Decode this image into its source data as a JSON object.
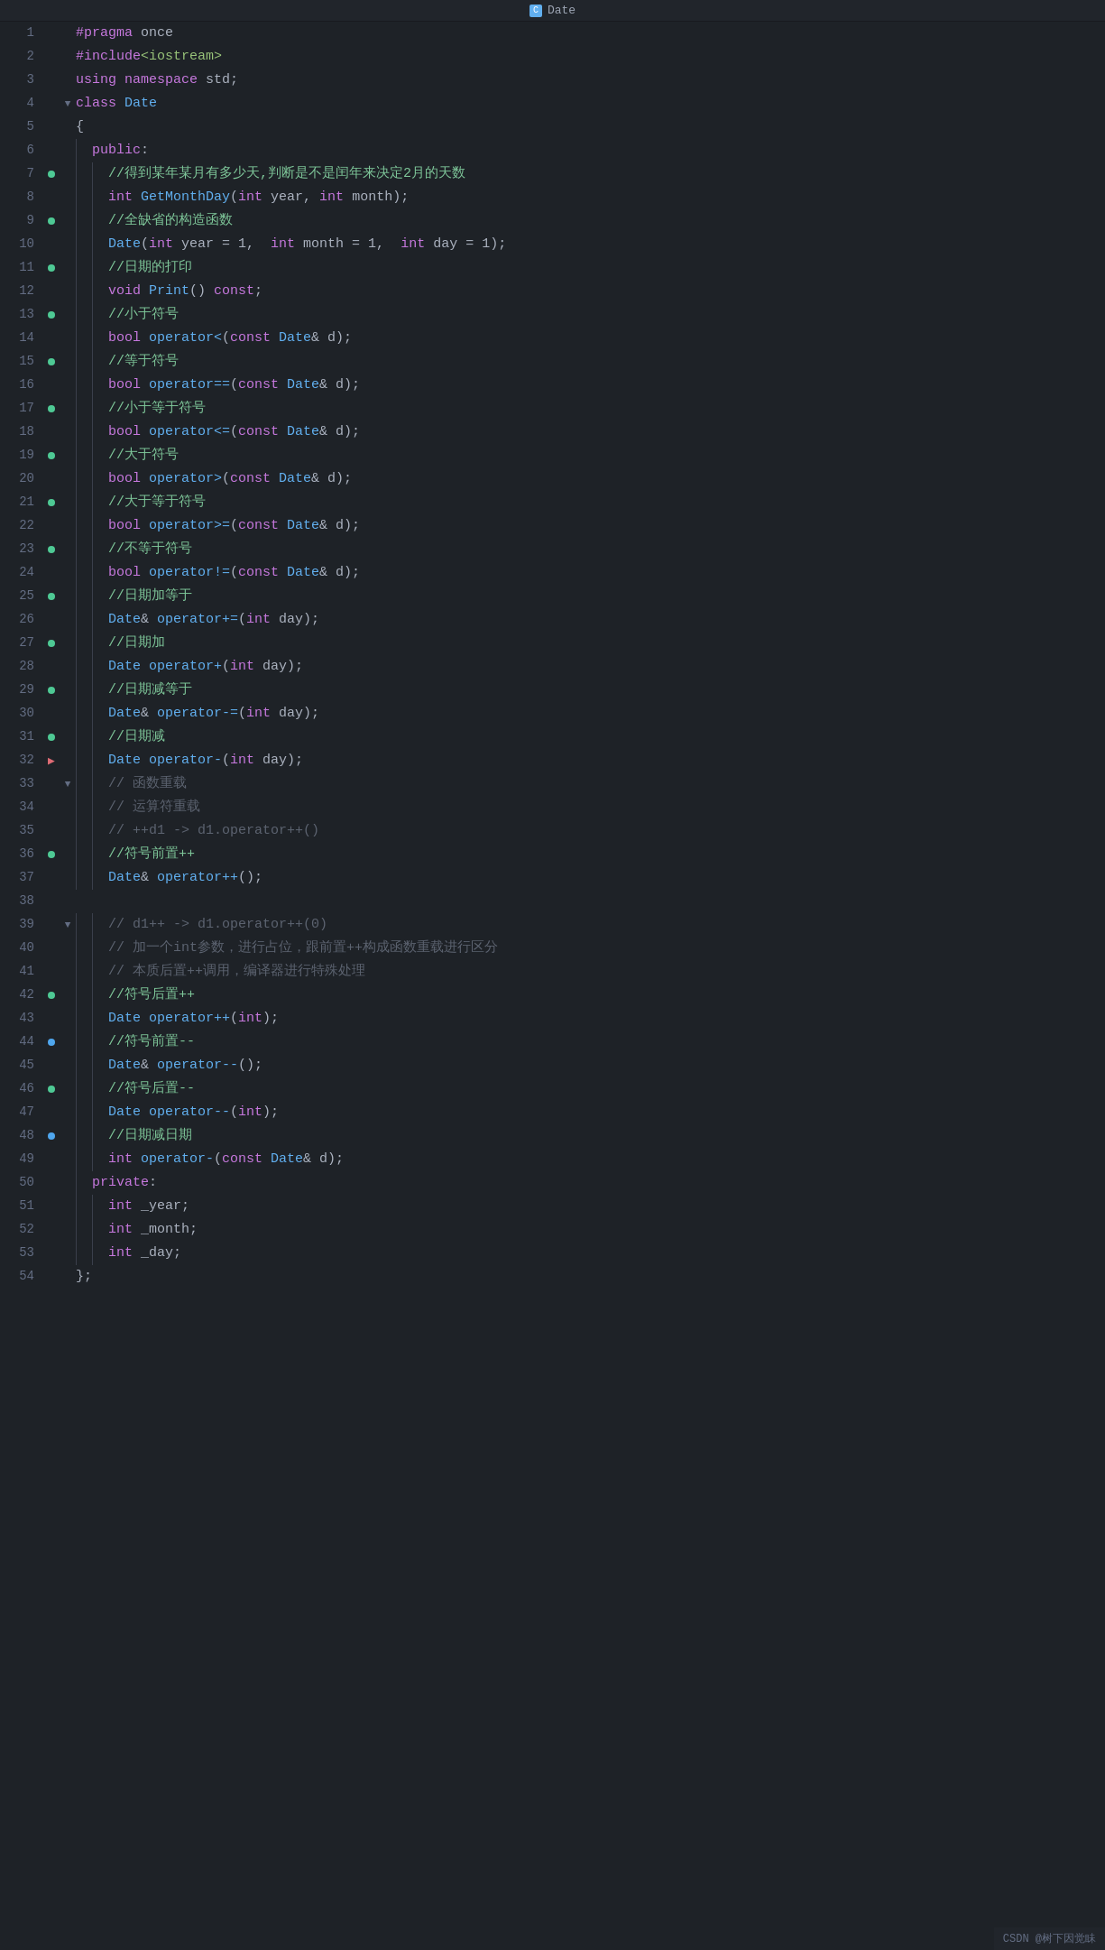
{
  "title": "Date",
  "title_icon": "C",
  "footer_text": "CSDN @树下因觉眛",
  "lines": [
    {
      "num": 1,
      "gutter": "",
      "fold": "",
      "indent": 0,
      "tokens": [
        {
          "t": "kw",
          "v": "#pragma"
        },
        {
          "t": "plain",
          "v": " once"
        }
      ]
    },
    {
      "num": 2,
      "gutter": "",
      "fold": "",
      "indent": 0,
      "tokens": [
        {
          "t": "kw",
          "v": "#include"
        },
        {
          "t": "inc",
          "v": "<iostream>"
        }
      ]
    },
    {
      "num": 3,
      "gutter": "",
      "fold": "",
      "indent": 0,
      "tokens": [
        {
          "t": "kw",
          "v": "using"
        },
        {
          "t": "plain",
          "v": " "
        },
        {
          "t": "kw",
          "v": "namespace"
        },
        {
          "t": "plain",
          "v": " std;"
        }
      ]
    },
    {
      "num": 4,
      "gutter": "",
      "fold": "▼",
      "indent": 0,
      "tokens": [
        {
          "t": "kw",
          "v": "class"
        },
        {
          "t": "plain",
          "v": " "
        },
        {
          "t": "kw-blue",
          "v": "Date"
        }
      ]
    },
    {
      "num": 5,
      "gutter": "",
      "fold": "",
      "indent": 0,
      "tokens": [
        {
          "t": "plain",
          "v": "{"
        }
      ]
    },
    {
      "num": 6,
      "gutter": "",
      "fold": "",
      "indent": 1,
      "tokens": [
        {
          "t": "kw",
          "v": "public"
        },
        {
          "t": "plain",
          "v": ":"
        }
      ]
    },
    {
      "num": 7,
      "gutter": "green",
      "fold": "",
      "indent": 2,
      "tokens": [
        {
          "t": "comment-cn",
          "v": "//得到某年某月有多少天,判断是不是闰年来决定2月的天数"
        }
      ]
    },
    {
      "num": 8,
      "gutter": "",
      "fold": "",
      "indent": 2,
      "tokens": [
        {
          "t": "kw",
          "v": "int"
        },
        {
          "t": "plain",
          "v": " "
        },
        {
          "t": "fn",
          "v": "GetMonthDay"
        },
        {
          "t": "plain",
          "v": "("
        },
        {
          "t": "kw",
          "v": "int"
        },
        {
          "t": "plain",
          "v": " year, "
        },
        {
          "t": "kw",
          "v": "int"
        },
        {
          "t": "plain",
          "v": " month);"
        }
      ]
    },
    {
      "num": 9,
      "gutter": "green",
      "fold": "",
      "indent": 2,
      "tokens": [
        {
          "t": "comment-cn",
          "v": "//全缺省的构造函数"
        }
      ]
    },
    {
      "num": 10,
      "gutter": "",
      "fold": "",
      "indent": 2,
      "tokens": [
        {
          "t": "kw-blue",
          "v": "Date"
        },
        {
          "t": "plain",
          "v": "("
        },
        {
          "t": "kw",
          "v": "int"
        },
        {
          "t": "plain",
          "v": " year = 1,  "
        },
        {
          "t": "kw",
          "v": "int"
        },
        {
          "t": "plain",
          "v": " month = 1,  "
        },
        {
          "t": "kw",
          "v": "int"
        },
        {
          "t": "plain",
          "v": " day = 1);"
        }
      ]
    },
    {
      "num": 11,
      "gutter": "green",
      "fold": "",
      "indent": 2,
      "tokens": [
        {
          "t": "comment-cn",
          "v": "//日期的打印"
        }
      ]
    },
    {
      "num": 12,
      "gutter": "",
      "fold": "",
      "indent": 2,
      "tokens": [
        {
          "t": "kw",
          "v": "void"
        },
        {
          "t": "plain",
          "v": " "
        },
        {
          "t": "fn",
          "v": "Print"
        },
        {
          "t": "plain",
          "v": "() "
        },
        {
          "t": "kw",
          "v": "const"
        },
        {
          "t": "plain",
          "v": ";"
        }
      ]
    },
    {
      "num": 13,
      "gutter": "green",
      "fold": "",
      "indent": 2,
      "tokens": [
        {
          "t": "comment-cn",
          "v": "//小于符号"
        }
      ]
    },
    {
      "num": 14,
      "gutter": "",
      "fold": "",
      "indent": 2,
      "tokens": [
        {
          "t": "kw",
          "v": "bool"
        },
        {
          "t": "plain",
          "v": " "
        },
        {
          "t": "fn",
          "v": "operator<"
        },
        {
          "t": "plain",
          "v": "("
        },
        {
          "t": "kw",
          "v": "const"
        },
        {
          "t": "plain",
          "v": " "
        },
        {
          "t": "kw-blue",
          "v": "Date"
        },
        {
          "t": "plain",
          "v": "& d);"
        }
      ]
    },
    {
      "num": 15,
      "gutter": "green",
      "fold": "",
      "indent": 2,
      "tokens": [
        {
          "t": "comment-cn",
          "v": "//等于符号"
        }
      ]
    },
    {
      "num": 16,
      "gutter": "",
      "fold": "",
      "indent": 2,
      "tokens": [
        {
          "t": "kw",
          "v": "bool"
        },
        {
          "t": "plain",
          "v": " "
        },
        {
          "t": "fn",
          "v": "operator=="
        },
        {
          "t": "plain",
          "v": "("
        },
        {
          "t": "kw",
          "v": "const"
        },
        {
          "t": "plain",
          "v": " "
        },
        {
          "t": "kw-blue",
          "v": "Date"
        },
        {
          "t": "plain",
          "v": "& d);"
        }
      ]
    },
    {
      "num": 17,
      "gutter": "green",
      "fold": "",
      "indent": 2,
      "tokens": [
        {
          "t": "comment-cn",
          "v": "//小于等于符号"
        }
      ]
    },
    {
      "num": 18,
      "gutter": "",
      "fold": "",
      "indent": 2,
      "tokens": [
        {
          "t": "kw",
          "v": "bool"
        },
        {
          "t": "plain",
          "v": " "
        },
        {
          "t": "fn",
          "v": "operator<="
        },
        {
          "t": "plain",
          "v": "("
        },
        {
          "t": "kw",
          "v": "const"
        },
        {
          "t": "plain",
          "v": " "
        },
        {
          "t": "kw-blue",
          "v": "Date"
        },
        {
          "t": "plain",
          "v": "& d);"
        }
      ]
    },
    {
      "num": 19,
      "gutter": "green",
      "fold": "",
      "indent": 2,
      "tokens": [
        {
          "t": "comment-cn",
          "v": "//大于符号"
        }
      ]
    },
    {
      "num": 20,
      "gutter": "",
      "fold": "",
      "indent": 2,
      "tokens": [
        {
          "t": "kw",
          "v": "bool"
        },
        {
          "t": "plain",
          "v": " "
        },
        {
          "t": "fn",
          "v": "operator>"
        },
        {
          "t": "plain",
          "v": "("
        },
        {
          "t": "kw",
          "v": "const"
        },
        {
          "t": "plain",
          "v": " "
        },
        {
          "t": "kw-blue",
          "v": "Date"
        },
        {
          "t": "plain",
          "v": "& d);"
        }
      ]
    },
    {
      "num": 21,
      "gutter": "green",
      "fold": "",
      "indent": 2,
      "tokens": [
        {
          "t": "comment-cn",
          "v": "//大于等于符号"
        }
      ]
    },
    {
      "num": 22,
      "gutter": "",
      "fold": "",
      "indent": 2,
      "tokens": [
        {
          "t": "kw",
          "v": "bool"
        },
        {
          "t": "plain",
          "v": " "
        },
        {
          "t": "fn",
          "v": "operator>="
        },
        {
          "t": "plain",
          "v": "("
        },
        {
          "t": "kw",
          "v": "const"
        },
        {
          "t": "plain",
          "v": " "
        },
        {
          "t": "kw-blue",
          "v": "Date"
        },
        {
          "t": "plain",
          "v": "& d);"
        }
      ]
    },
    {
      "num": 23,
      "gutter": "green",
      "fold": "",
      "indent": 2,
      "tokens": [
        {
          "t": "comment-cn",
          "v": "//不等于符号"
        }
      ]
    },
    {
      "num": 24,
      "gutter": "",
      "fold": "",
      "indent": 2,
      "tokens": [
        {
          "t": "kw",
          "v": "bool"
        },
        {
          "t": "plain",
          "v": " "
        },
        {
          "t": "fn",
          "v": "operator!="
        },
        {
          "t": "plain",
          "v": "("
        },
        {
          "t": "kw",
          "v": "const"
        },
        {
          "t": "plain",
          "v": " "
        },
        {
          "t": "kw-blue",
          "v": "Date"
        },
        {
          "t": "plain",
          "v": "& d);"
        }
      ]
    },
    {
      "num": 25,
      "gutter": "green",
      "fold": "",
      "indent": 2,
      "tokens": [
        {
          "t": "comment-cn",
          "v": "//日期加等于"
        }
      ]
    },
    {
      "num": 26,
      "gutter": "",
      "fold": "",
      "indent": 2,
      "tokens": [
        {
          "t": "kw-blue",
          "v": "Date"
        },
        {
          "t": "plain",
          "v": "& "
        },
        {
          "t": "fn",
          "v": "operator+="
        },
        {
          "t": "plain",
          "v": "("
        },
        {
          "t": "kw",
          "v": "int"
        },
        {
          "t": "plain",
          "v": " day);"
        }
      ]
    },
    {
      "num": 27,
      "gutter": "green",
      "fold": "",
      "indent": 2,
      "tokens": [
        {
          "t": "comment-cn",
          "v": "//日期加"
        }
      ]
    },
    {
      "num": 28,
      "gutter": "",
      "fold": "",
      "indent": 2,
      "tokens": [
        {
          "t": "kw-blue",
          "v": "Date"
        },
        {
          "t": "plain",
          "v": " "
        },
        {
          "t": "fn",
          "v": "operator+"
        },
        {
          "t": "plain",
          "v": "("
        },
        {
          "t": "kw",
          "v": "int"
        },
        {
          "t": "plain",
          "v": " day);"
        }
      ]
    },
    {
      "num": 29,
      "gutter": "green",
      "fold": "",
      "indent": 2,
      "tokens": [
        {
          "t": "comment-cn",
          "v": "//日期减等于"
        }
      ]
    },
    {
      "num": 30,
      "gutter": "",
      "fold": "",
      "indent": 2,
      "tokens": [
        {
          "t": "kw-blue",
          "v": "Date"
        },
        {
          "t": "plain",
          "v": "& "
        },
        {
          "t": "fn",
          "v": "operator-="
        },
        {
          "t": "plain",
          "v": "("
        },
        {
          "t": "kw",
          "v": "int"
        },
        {
          "t": "plain",
          "v": " day);"
        }
      ]
    },
    {
      "num": 31,
      "gutter": "green",
      "fold": "",
      "indent": 2,
      "tokens": [
        {
          "t": "comment-cn",
          "v": "//日期减"
        }
      ]
    },
    {
      "num": 32,
      "gutter": "arrow",
      "fold": "",
      "indent": 2,
      "tokens": [
        {
          "t": "kw-blue",
          "v": "Date"
        },
        {
          "t": "plain",
          "v": " "
        },
        {
          "t": "fn",
          "v": "operator-"
        },
        {
          "t": "plain",
          "v": "("
        },
        {
          "t": "kw",
          "v": "int"
        },
        {
          "t": "plain",
          "v": " day);"
        }
      ]
    },
    {
      "num": 33,
      "gutter": "",
      "fold": "▼",
      "indent": 2,
      "tokens": [
        {
          "t": "comment",
          "v": "// 函数重载"
        }
      ]
    },
    {
      "num": 34,
      "gutter": "",
      "fold": "",
      "indent": 2,
      "tokens": [
        {
          "t": "comment",
          "v": "// 运算符重载"
        }
      ]
    },
    {
      "num": 35,
      "gutter": "",
      "fold": "",
      "indent": 2,
      "tokens": [
        {
          "t": "comment",
          "v": "// ++d1 -> d1.operator++()"
        }
      ]
    },
    {
      "num": 36,
      "gutter": "green",
      "fold": "",
      "indent": 2,
      "tokens": [
        {
          "t": "comment-cn",
          "v": "//符号前置++"
        }
      ]
    },
    {
      "num": 37,
      "gutter": "",
      "fold": "",
      "indent": 2,
      "tokens": [
        {
          "t": "kw-blue",
          "v": "Date"
        },
        {
          "t": "plain",
          "v": "& "
        },
        {
          "t": "fn",
          "v": "operator++"
        },
        {
          "t": "plain",
          "v": "();"
        }
      ]
    },
    {
      "num": 38,
      "gutter": "",
      "fold": "",
      "indent": 0,
      "tokens": []
    },
    {
      "num": 39,
      "gutter": "",
      "fold": "▼",
      "indent": 2,
      "tokens": [
        {
          "t": "comment",
          "v": "// d1++ -> d1.operator++(0)"
        }
      ]
    },
    {
      "num": 40,
      "gutter": "",
      "fold": "",
      "indent": 2,
      "tokens": [
        {
          "t": "comment",
          "v": "// 加一个int参数，进行占位，跟前置++构成函数重载进行区分"
        }
      ]
    },
    {
      "num": 41,
      "gutter": "",
      "fold": "",
      "indent": 2,
      "tokens": [
        {
          "t": "comment",
          "v": "// 本质后置++调用，编译器进行特殊处理"
        }
      ]
    },
    {
      "num": 42,
      "gutter": "green",
      "fold": "",
      "indent": 2,
      "tokens": [
        {
          "t": "comment-cn",
          "v": "//符号后置++"
        }
      ]
    },
    {
      "num": 43,
      "gutter": "",
      "fold": "",
      "indent": 2,
      "tokens": [
        {
          "t": "kw-blue",
          "v": "Date"
        },
        {
          "t": "plain",
          "v": " "
        },
        {
          "t": "fn",
          "v": "operator++"
        },
        {
          "t": "plain",
          "v": "("
        },
        {
          "t": "kw",
          "v": "int"
        },
        {
          "t": "plain",
          "v": ");"
        }
      ]
    },
    {
      "num": 44,
      "gutter": "blue",
      "fold": "",
      "indent": 2,
      "tokens": [
        {
          "t": "comment-cn",
          "v": "//符号前置--"
        }
      ]
    },
    {
      "num": 45,
      "gutter": "",
      "fold": "",
      "indent": 2,
      "tokens": [
        {
          "t": "kw-blue",
          "v": "Date"
        },
        {
          "t": "plain",
          "v": "& "
        },
        {
          "t": "fn",
          "v": "operator--"
        },
        {
          "t": "plain",
          "v": "();"
        }
      ]
    },
    {
      "num": 46,
      "gutter": "green",
      "fold": "",
      "indent": 2,
      "tokens": [
        {
          "t": "comment-cn",
          "v": "//符号后置--"
        }
      ]
    },
    {
      "num": 47,
      "gutter": "",
      "fold": "",
      "indent": 2,
      "tokens": [
        {
          "t": "kw-blue",
          "v": "Date"
        },
        {
          "t": "plain",
          "v": " "
        },
        {
          "t": "fn",
          "v": "operator--"
        },
        {
          "t": "plain",
          "v": "("
        },
        {
          "t": "kw",
          "v": "int"
        },
        {
          "t": "plain",
          "v": ");"
        }
      ]
    },
    {
      "num": 48,
      "gutter": "blue",
      "fold": "",
      "indent": 2,
      "tokens": [
        {
          "t": "comment-cn",
          "v": "//日期减日期"
        }
      ]
    },
    {
      "num": 49,
      "gutter": "",
      "fold": "",
      "indent": 2,
      "tokens": [
        {
          "t": "kw",
          "v": "int"
        },
        {
          "t": "plain",
          "v": " "
        },
        {
          "t": "fn",
          "v": "operator-"
        },
        {
          "t": "plain",
          "v": "("
        },
        {
          "t": "kw",
          "v": "const"
        },
        {
          "t": "plain",
          "v": " "
        },
        {
          "t": "kw-blue",
          "v": "Date"
        },
        {
          "t": "plain",
          "v": "& d);"
        }
      ]
    },
    {
      "num": 50,
      "gutter": "",
      "fold": "",
      "indent": 1,
      "tokens": [
        {
          "t": "kw",
          "v": "private"
        },
        {
          "t": "plain",
          "v": ":"
        }
      ]
    },
    {
      "num": 51,
      "gutter": "",
      "fold": "",
      "indent": 2,
      "tokens": [
        {
          "t": "kw",
          "v": "int"
        },
        {
          "t": "plain",
          "v": " _year;"
        }
      ]
    },
    {
      "num": 52,
      "gutter": "",
      "fold": "",
      "indent": 2,
      "tokens": [
        {
          "t": "kw",
          "v": "int"
        },
        {
          "t": "plain",
          "v": " _month;"
        }
      ]
    },
    {
      "num": 53,
      "gutter": "",
      "fold": "",
      "indent": 2,
      "tokens": [
        {
          "t": "kw",
          "v": "int"
        },
        {
          "t": "plain",
          "v": " _day;"
        }
      ]
    },
    {
      "num": 54,
      "gutter": "",
      "fold": "",
      "indent": 0,
      "tokens": [
        {
          "t": "plain",
          "v": "};"
        }
      ]
    }
  ]
}
